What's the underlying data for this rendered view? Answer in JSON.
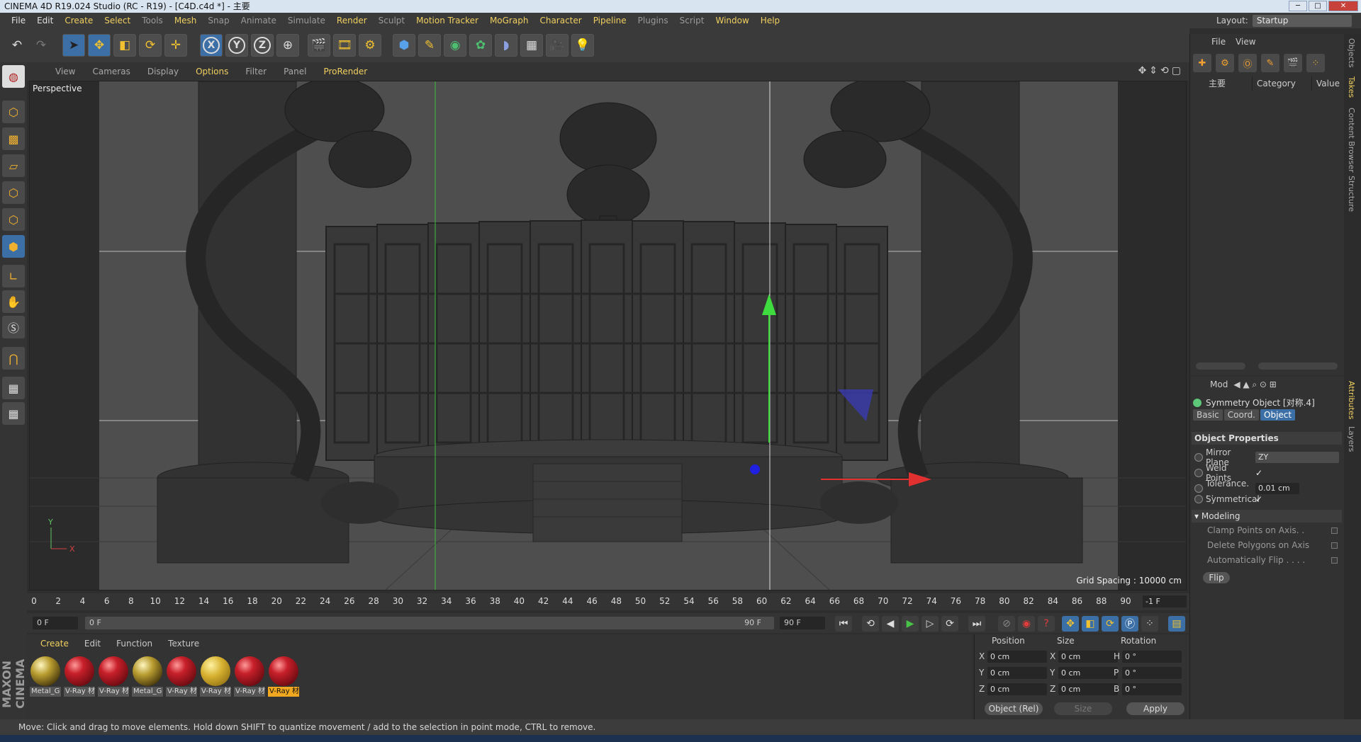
{
  "window": {
    "title": "CINEMA 4D R19.024 Studio (RC - R19) - [C4D.c4d *] - 主要",
    "min": "─",
    "max": "□",
    "close": "✕"
  },
  "menu": [
    "File",
    "Edit",
    "Create",
    "Select",
    "Tools",
    "Mesh",
    "Snap",
    "Animate",
    "Simulate",
    "Render",
    "Sculpt",
    "Motion Tracker",
    "MoGraph",
    "Character",
    "Pipeline",
    "Plugins",
    "Script",
    "Window",
    "Help"
  ],
  "layout": {
    "label": "Layout:",
    "value": "Startup"
  },
  "toolbar": {
    "axis_x": "X",
    "axis_y": "Y",
    "axis_z": "Z"
  },
  "viewport": {
    "menu": [
      "View",
      "Cameras",
      "Display",
      "Options",
      "Filter",
      "Panel",
      "ProRender"
    ],
    "active_menu": "Options",
    "label": "Perspective",
    "grid_spacing": "Grid Spacing : 10000 cm",
    "nav_icons": "✥⇕⟲▢"
  },
  "timeline": {
    "ticks": [
      "0",
      "2",
      "4",
      "6",
      "8",
      "10",
      "12",
      "14",
      "16",
      "18",
      "20",
      "22",
      "24",
      "26",
      "28",
      "30",
      "32",
      "34",
      "36",
      "38",
      "40",
      "42",
      "44",
      "46",
      "48",
      "50",
      "52",
      "54",
      "56",
      "58",
      "60",
      "62",
      "64",
      "66",
      "68",
      "70",
      "72",
      "74",
      "76",
      "78",
      "80",
      "82",
      "84",
      "86",
      "88",
      "90"
    ],
    "current_frame": "-1 F"
  },
  "range": {
    "start": "0 F",
    "slider_start": "0 F",
    "slider_end": "90 F",
    "end": "90 F"
  },
  "playback_icons": [
    "⏮",
    "⟲",
    "◀",
    "▶",
    "▷",
    "⟳",
    "⏭"
  ],
  "materials": {
    "tabs": [
      "Create",
      "Edit",
      "Function",
      "Texture"
    ],
    "items": [
      {
        "name": "Metal_G",
        "style": "gold"
      },
      {
        "name": "V-Ray 材",
        "style": "red"
      },
      {
        "name": "V-Ray 材",
        "style": "red"
      },
      {
        "name": "Metal_G",
        "style": "gold"
      },
      {
        "name": "V-Ray 材",
        "style": "red"
      },
      {
        "name": "V-Ray 材",
        "style": "yel"
      },
      {
        "name": "V-Ray 材",
        "style": "red"
      },
      {
        "name": "V-Ray 材",
        "style": "red",
        "selected": true
      }
    ]
  },
  "brand": "MAXON CINEMA 4D",
  "coords": {
    "headers": {
      "position": "Position",
      "size": "Size",
      "rotation": "Rotation"
    },
    "rows": [
      {
        "axis": "X",
        "pos": "0 cm",
        "saxis": "X",
        "size": "0 cm",
        "raxis": "H",
        "rot": "0 °"
      },
      {
        "axis": "Y",
        "pos": "0 cm",
        "saxis": "Y",
        "size": "0 cm",
        "raxis": "P",
        "rot": "0 °"
      },
      {
        "axis": "Z",
        "pos": "0 cm",
        "saxis": "Z",
        "size": "0 cm",
        "raxis": "B",
        "rot": "0 °"
      }
    ],
    "mode": "Object (Rel)",
    "size_mode": "Size",
    "apply": "Apply"
  },
  "status": "Move: Click and drag to move elements. Hold down SHIFT to quantize movement / add to the selection in point mode, CTRL to remove.",
  "objects": {
    "menu": [
      "File",
      "View"
    ],
    "columns": {
      "name": "主要",
      "category": "Category",
      "value": "Value"
    }
  },
  "side_tabs": [
    "Objects",
    "Takes",
    "Content Browser",
    "Structure",
    "Attributes",
    "Layers"
  ],
  "attributes": {
    "menu": "Mod",
    "object_name": "Symmetry Object [对称.4]",
    "tabs": [
      "Basic",
      "Coord.",
      "Object"
    ],
    "active_tab": "Object",
    "section": "Object Properties",
    "mirror_plane": {
      "label": "Mirror Plane",
      "value": "ZY"
    },
    "weld_points": {
      "label": "Weld Points",
      "check": "✓"
    },
    "tolerance": {
      "label": "Tolerance. . .",
      "value": "0.01 cm"
    },
    "symmetrical": {
      "label": "Symmetrical",
      "check": "✓"
    },
    "modeling": "Modeling",
    "clamp": "Clamp Points on Axis. .",
    "delete": "Delete Polygons on Axis",
    "autoflip": "Automatically Flip . . . .",
    "flip": "Flip"
  },
  "colors": {
    "accent": "#f0d060",
    "blue": "#3c6fa6",
    "viewport_bg": "#4e4e4e"
  }
}
